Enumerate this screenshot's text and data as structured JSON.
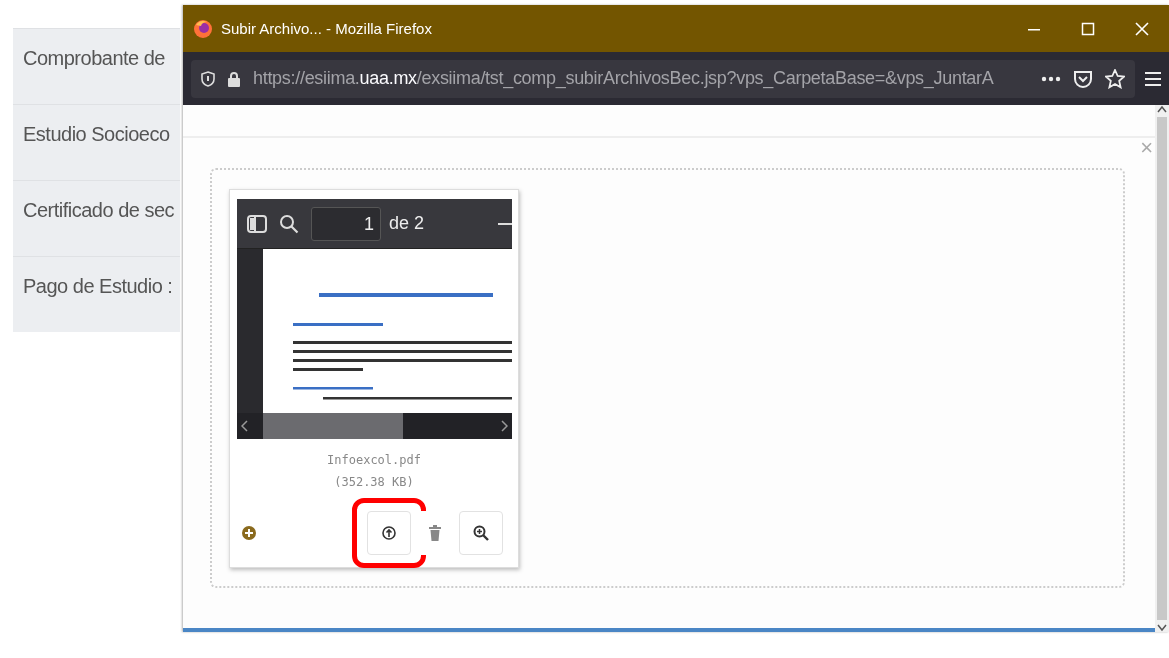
{
  "background_page": {
    "items": [
      {
        "label": "Comprobante de"
      },
      {
        "label": "Estudio Socioeco"
      },
      {
        "label": "Certificado de sec"
      },
      {
        "label": "Pago de Estudio :"
      }
    ]
  },
  "browser_window": {
    "title": "Subir Archivo... - Mozilla Firefox",
    "url": "https://esiima.**uaa.mx**/exsiima/tst_comp_subirArchivosBec.jsp?vps_CarpetaBase=&vps_JuntarA",
    "upload_area": {
      "close": "×",
      "file_card": {
        "pdf_viewer": {
          "page_number": "1",
          "page_count": "de 2"
        },
        "file_name": "Infoexcol.pdf",
        "file_size": "(352.38 KB)",
        "buttons": [
          {
            "kind": "upload",
            "highlighted": true
          },
          {
            "kind": "delete",
            "highlighted": false
          },
          {
            "kind": "zoom",
            "highlighted": false
          }
        ]
      }
    }
  }
}
